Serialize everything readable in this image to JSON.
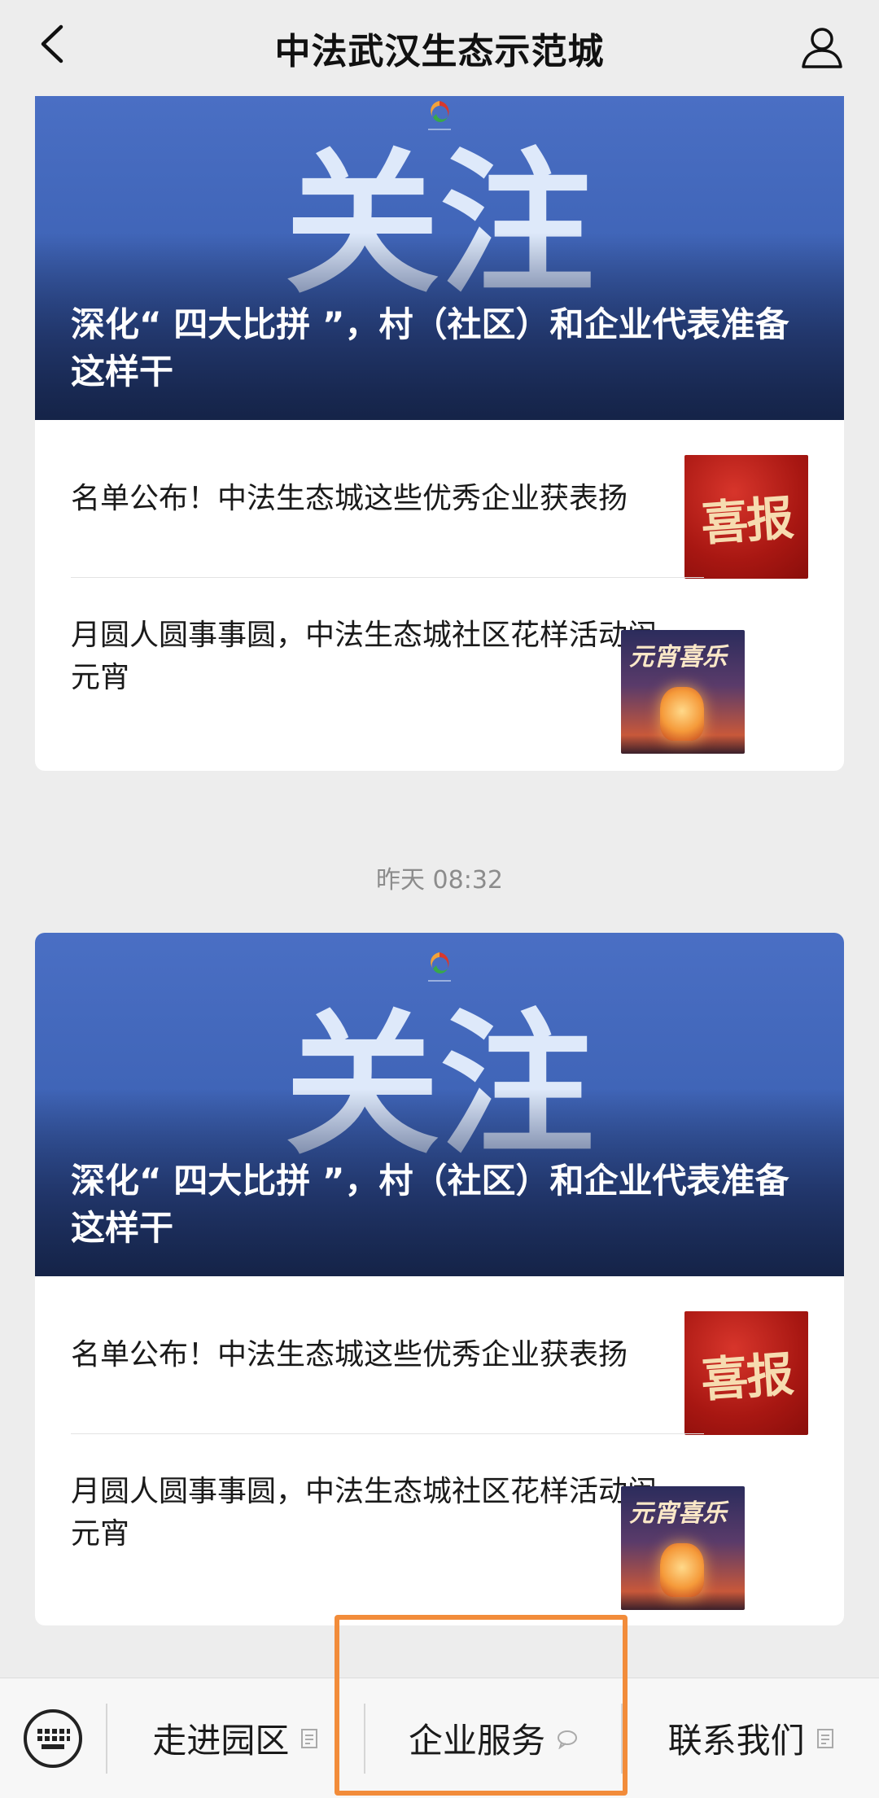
{
  "header": {
    "title": "中法武汉生态示范城",
    "back_icon": "chevron-left-icon",
    "profile_icon": "user-icon"
  },
  "feed": [
    {
      "cover": {
        "big_text": "关注",
        "headline": "深化“ 四大比拼 ”，村（社区）和企业代表准备这样干"
      },
      "items": [
        {
          "title": "名单公布！中法生态城这些优秀企业获表扬",
          "thumb_text": "喜报"
        },
        {
          "title": "月圆人圆事事圆，中法生态城社区花样活动闹元宵",
          "thumb_text": "元宵喜乐"
        }
      ]
    },
    {
      "timestamp": "昨天 08:32",
      "cover": {
        "big_text": "关注",
        "headline": "深化“ 四大比拼 ”，村（社区）和企业代表准备这样干"
      },
      "items": [
        {
          "title": "名单公布！中法生态城这些优秀企业获表扬",
          "thumb_text": "喜报"
        },
        {
          "title": "月圆人圆事事圆，中法生态城社区花样活动闹元宵",
          "thumb_text": "元宵喜乐"
        }
      ]
    }
  ],
  "menu": {
    "keyboard_icon": "keyboard-icon",
    "tabs": [
      {
        "label": "走进园区",
        "icon": "page-icon"
      },
      {
        "label": "企业服务",
        "icon": "chat-bubble-icon"
      },
      {
        "label": "联系我们",
        "icon": "page-icon"
      }
    ]
  },
  "colors": {
    "highlight": "#f28c3a",
    "cover_blue": "#4065b8"
  }
}
